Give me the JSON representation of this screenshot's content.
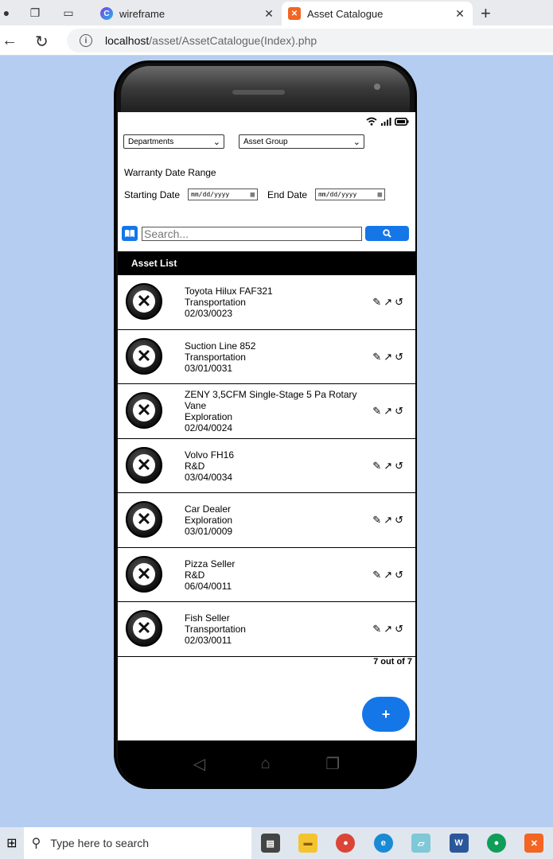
{
  "browser": {
    "tabs": [
      {
        "title": "wireframe",
        "close": "✕"
      },
      {
        "title": "Asset Catalogue",
        "close": "✕"
      }
    ],
    "new_tab": "+",
    "url_host": "localhost",
    "url_path": "/asset/AssetCatalogue(Index).php"
  },
  "filters": {
    "departments": "Departments",
    "asset_group": "Asset Group",
    "warranty_label": "Warranty Date Range",
    "start_label": "Starting Date",
    "end_label": "End Date",
    "date_placeholder": "mm/dd/yyyy"
  },
  "search": {
    "placeholder": "Search..."
  },
  "list": {
    "header": "Asset List",
    "items": [
      {
        "name": "Toyota Hilux FAF321",
        "department": "Transportation",
        "date": "02/03/0023"
      },
      {
        "name": "Suction Line 852",
        "department": "Transportation",
        "date": "03/01/0031"
      },
      {
        "name": "ZENY 3,5CFM Single-Stage 5 Pa Rotary Vane",
        "department": "Exploration",
        "date": "02/04/0024"
      },
      {
        "name": "Volvo FH16",
        "department": "R&D",
        "date": "03/04/0034"
      },
      {
        "name": "Car Dealer",
        "department": "Exploration",
        "date": "03/01/0009"
      },
      {
        "name": "Pizza Seller",
        "department": "R&D",
        "date": "06/04/0011"
      },
      {
        "name": "Fish Seller",
        "department": "Transportation",
        "date": "02/03/0011"
      }
    ],
    "count": "7 out of 7"
  },
  "fab_label": "+",
  "taskbar": {
    "search_text": "Type here to search"
  },
  "colors": {
    "accent": "#1576e8",
    "page_bg": "#b5cdf0"
  }
}
